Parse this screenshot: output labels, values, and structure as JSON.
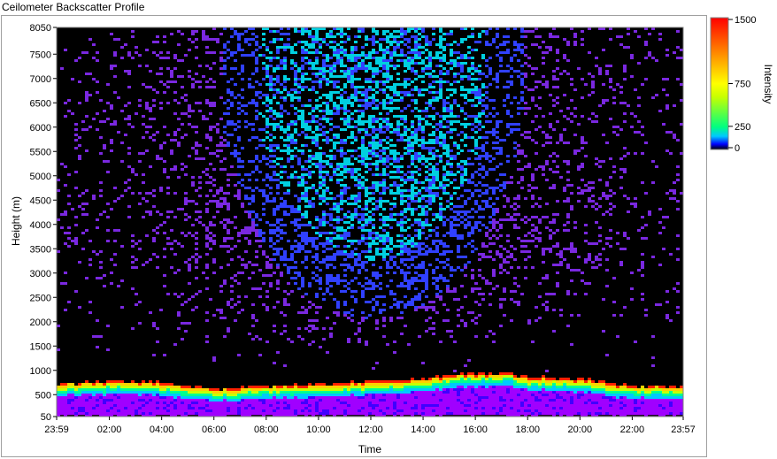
{
  "window": {
    "title": "Ceilometer Backscatter Profile"
  },
  "chart_data": {
    "type": "heatmap",
    "title": "Ceilometer Backscatter Profile",
    "xlabel": "Time",
    "ylabel": "Height (m)",
    "x_ticks": [
      "23:59",
      "02:00",
      "04:00",
      "06:00",
      "08:00",
      "10:00",
      "12:00",
      "14:00",
      "16:00",
      "18:00",
      "20:00",
      "22:00",
      "23:57"
    ],
    "x_range_hours": [
      -0.0167,
      23.95
    ],
    "y_ticks": [
      50,
      500,
      1000,
      1500,
      2000,
      2500,
      3000,
      3500,
      4000,
      4500,
      5000,
      5500,
      6000,
      6500,
      7000,
      7500,
      8050
    ],
    "ylim": [
      50,
      8050
    ],
    "colorbar": {
      "label": "Intensity",
      "ticks": [
        0,
        250,
        750,
        1500
      ],
      "range": [
        0,
        1500
      ],
      "colors": [
        "#000000",
        "#0000ff",
        "#00c8ff",
        "#00ff80",
        "#c8ff00",
        "#ffff00",
        "#ff8000",
        "#ff0000"
      ]
    },
    "features": {
      "boundary_layer_top_m": [
        [
          0,
          750
        ],
        [
          2,
          800
        ],
        [
          4,
          780
        ],
        [
          6,
          650
        ],
        [
          8,
          700
        ],
        [
          10,
          740
        ],
        [
          12,
          800
        ],
        [
          14,
          850
        ],
        [
          15,
          950
        ],
        [
          17,
          980
        ],
        [
          18,
          900
        ],
        [
          20,
          850
        ],
        [
          22,
          700
        ],
        [
          23.95,
          700
        ]
      ],
      "upper_haze_top_m": 8050,
      "upper_haze_peak_hours": [
        6,
        18
      ]
    }
  }
}
